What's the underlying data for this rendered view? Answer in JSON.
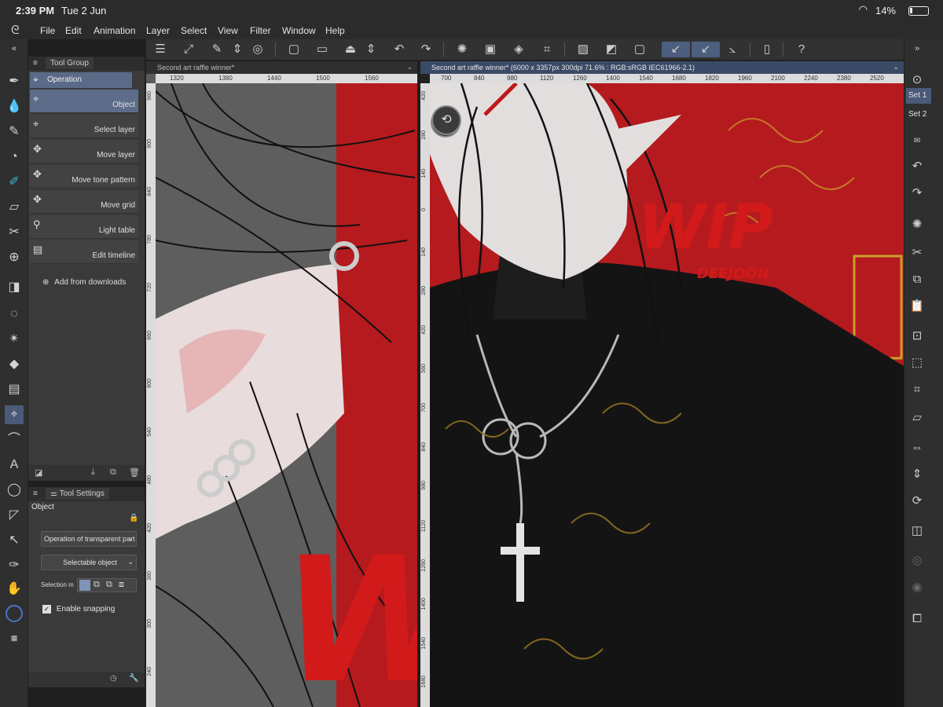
{
  "status_bar": {
    "time": "2:39 PM",
    "date": "Tue 2 Jun",
    "battery": "14%"
  },
  "menu": [
    "File",
    "Edit",
    "Animation",
    "Layer",
    "Select",
    "View",
    "Filter",
    "Window",
    "Help"
  ],
  "tool_group": {
    "tab": "Tool Group",
    "header": "Operation",
    "items": [
      {
        "label": "Object",
        "icon": "object-select-icon"
      },
      {
        "label": "Select layer",
        "icon": "select-layer-icon"
      },
      {
        "label": "Move layer",
        "icon": "move-icon"
      },
      {
        "label": "Move tone pattern",
        "icon": "move-icon"
      },
      {
        "label": "Move grid",
        "icon": "move-icon"
      },
      {
        "label": "Light table",
        "icon": "light-table-icon"
      },
      {
        "label": "Edit timeline",
        "icon": "timeline-icon"
      }
    ],
    "add_downloads": "Add from downloads"
  },
  "tool_settings": {
    "tab": "Tool Settings",
    "section": "Object",
    "dropdown1": "Operation of transparent part",
    "dropdown2": "Selectable object",
    "selection_mode_label": "Selection m",
    "enable_snapping": "Enable snapping"
  },
  "left_view": {
    "title": "Second art raffle winner*",
    "ruler_h": [
      "1320",
      "1380",
      "1440",
      "1500",
      "1560"
    ],
    "ruler_v": [
      "960",
      "900",
      "840",
      "780",
      "720",
      "660",
      "600",
      "540",
      "480",
      "420",
      "360",
      "300",
      "240"
    ]
  },
  "right_view": {
    "title": "Second art raffle winner* (6000 x 3357px 300dpi 71.6% : RGB:sRGB IEC61966-2.1)",
    "ruler_h": [
      "700",
      "840",
      "980",
      "1120",
      "1260",
      "1400",
      "1540",
      "1680",
      "1820",
      "1960",
      "2100",
      "2240",
      "2380",
      "2520"
    ],
    "ruler_v": [
      "420",
      "280",
      "140",
      "0",
      "140",
      "280",
      "420",
      "560",
      "700",
      "840",
      "980",
      "1120",
      "1260",
      "1400",
      "1540",
      "1680"
    ]
  },
  "artwork": {
    "watermark": "WIP",
    "signature": "DEEJOON"
  },
  "right_strip": {
    "set1": "Set 1",
    "set2": "Set 2"
  },
  "colors": {
    "accent": "#4a5a78",
    "panel": "#3a3a3a",
    "background": "#1f1f1f",
    "wip_red": "#d21a1a",
    "art_red": "#b51a1e"
  }
}
